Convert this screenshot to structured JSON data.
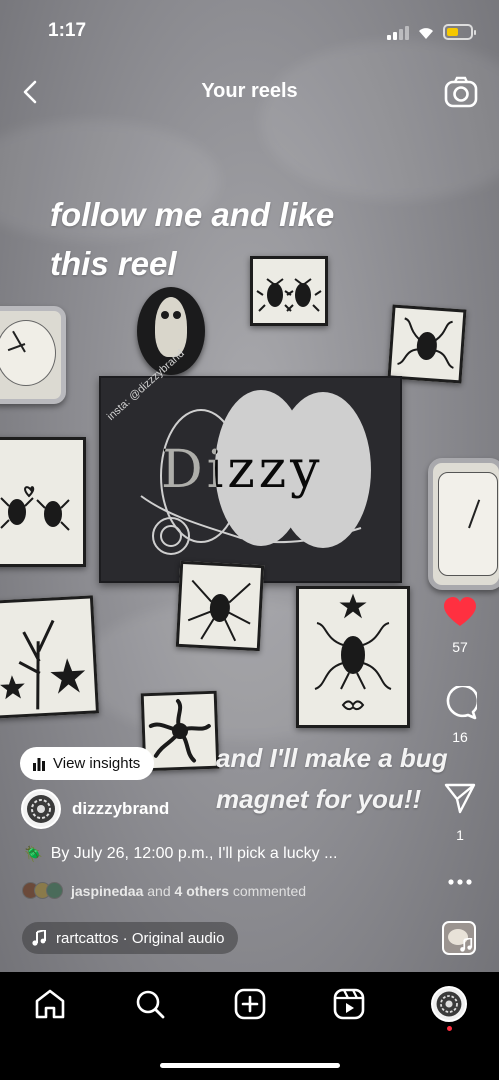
{
  "status_bar": {
    "time": "1:17"
  },
  "header": {
    "title": "Your reels"
  },
  "overlay": {
    "line1": "follow me and like",
    "line2": "this reel",
    "line3": "and I'll make a bug",
    "line4": "magnet for you!!"
  },
  "scene": {
    "card_text": "Dizzy",
    "card_handle": "insta: @dizzzybrand"
  },
  "actions": {
    "likes": "57",
    "comments": "16",
    "shares": "1"
  },
  "post": {
    "insights_label": "View insights",
    "username": "dizzzybrand",
    "caption": "By July 26, 12:00 p.m., I'll pick a lucky ...",
    "caption_emoji": "🪲",
    "commenter": "jaspinedaa",
    "comment_and": "and",
    "comment_others": "4 others",
    "comment_suffix": "commented",
    "audio": "rartcattos · Original audio"
  },
  "colors": {
    "like": "#ff3040",
    "battery": "#f5c800",
    "notification_dot": "#ff3040"
  },
  "icons": [
    "back-icon",
    "camera-icon",
    "heart-icon",
    "comment-icon",
    "share-icon",
    "more-icon",
    "music-icon",
    "insights-icon",
    "home-icon",
    "search-icon",
    "create-icon",
    "reels-icon",
    "profile-icon"
  ]
}
